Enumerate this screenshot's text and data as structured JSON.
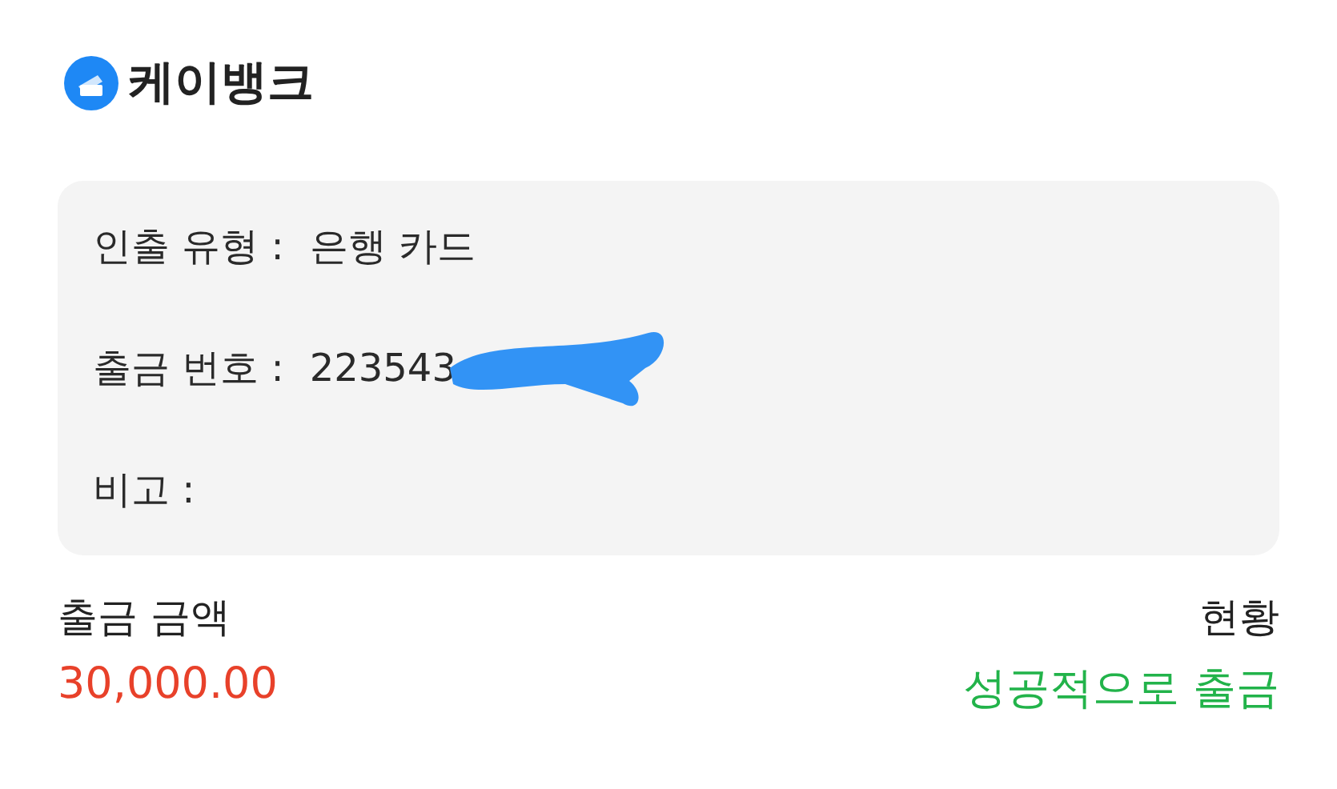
{
  "brand": {
    "name": "케이뱅크"
  },
  "details": [
    {
      "label": "인출 유형 :",
      "value": "은행 카드",
      "redacted": false
    },
    {
      "label": "출금 번호 :",
      "value": "223543",
      "redacted": true
    },
    {
      "label": "비고 :",
      "redacted": false
    }
  ],
  "amount": {
    "label": "출금 금액",
    "value": "30,000.00"
  },
  "status": {
    "label": "현황",
    "value": "성공적으로 출금"
  }
}
